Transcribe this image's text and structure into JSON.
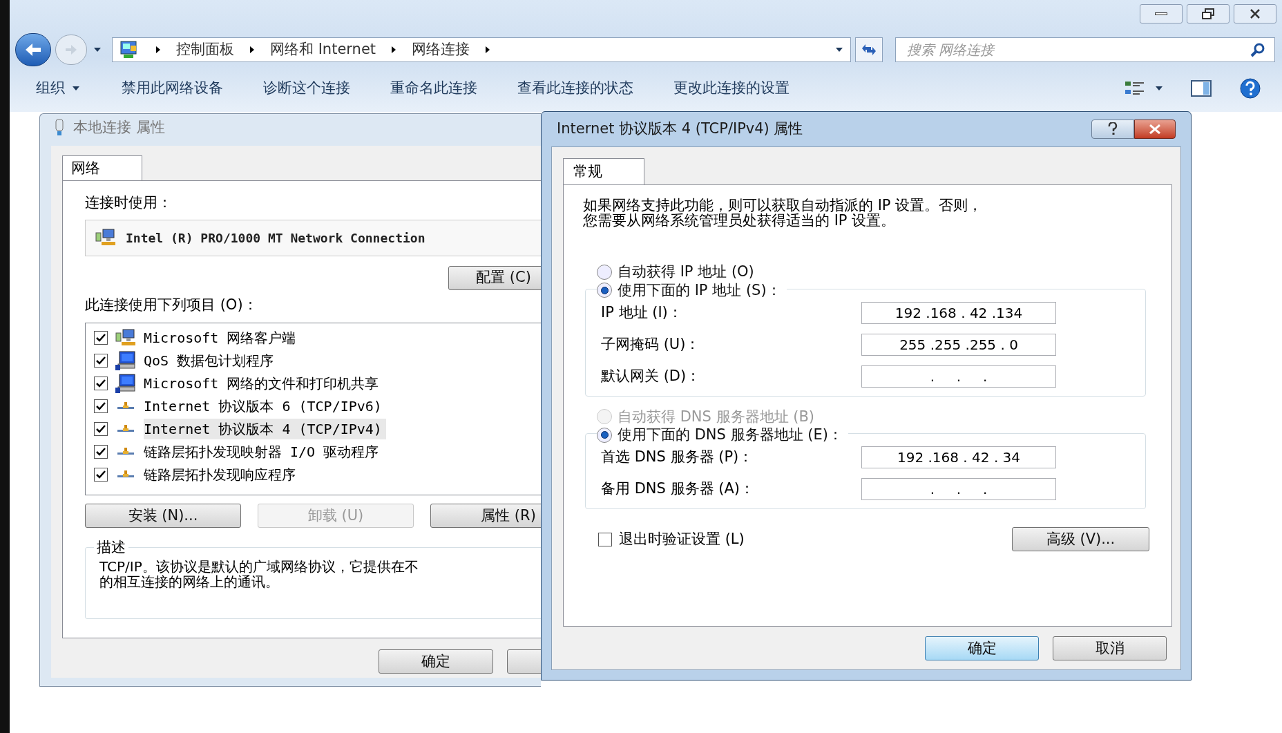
{
  "explorer": {
    "breadcrumb": [
      "控制面板",
      "网络和 Internet",
      "网络连接"
    ],
    "search": {
      "placeholder": "搜索 网络连接"
    },
    "toolbar": [
      {
        "label": "组织",
        "kind": "menu"
      },
      {
        "label": "禁用此网络设备",
        "kind": "action"
      },
      {
        "label": "诊断这个连接",
        "kind": "action"
      },
      {
        "label": "重命名此连接",
        "kind": "action"
      },
      {
        "label": "查看此连接的状态",
        "kind": "action"
      },
      {
        "label": "更改此连接的设置",
        "kind": "action"
      }
    ]
  },
  "properties_dialog": {
    "title": "本地连接 属性",
    "tabs": [
      {
        "label": "网络",
        "selected": true
      }
    ],
    "connect_using_label": "连接时使用：",
    "adapter": "Intel (R) PRO/1000 MT Network Connection",
    "configure_button": "配置 (C)",
    "items_label": "此连接使用下列项目 (O)：",
    "items": [
      {
        "label": "Microsoft 网络客户端",
        "kind": "client",
        "checked": true,
        "selected": false
      },
      {
        "label": "QoS 数据包计划程序",
        "kind": "service",
        "checked": true,
        "selected": false
      },
      {
        "label": "Microsoft 网络的文件和打印机共享",
        "kind": "service",
        "checked": true,
        "selected": false
      },
      {
        "label": "Internet 协议版本 6 (TCP/IPv6)",
        "kind": "protocol",
        "checked": true,
        "selected": false
      },
      {
        "label": "Internet 协议版本 4 (TCP/IPv4)",
        "kind": "protocol",
        "checked": true,
        "selected": true
      },
      {
        "label": "链路层拓扑发现映射器 I/O 驱动程序",
        "kind": "protocol",
        "checked": true,
        "selected": false
      },
      {
        "label": "链路层拓扑发现响应程序",
        "kind": "protocol",
        "checked": true,
        "selected": false
      }
    ],
    "buttons": [
      {
        "label": "安装 (N)...",
        "disabled": false
      },
      {
        "label": "卸载 (U)",
        "disabled": true
      },
      {
        "label": "属性 (R)",
        "disabled": false
      }
    ],
    "description": {
      "title": "描述",
      "lines": [
        "TCP/IP。该协议是默认的广域网络协议，它提供在不",
        "的相互连接的网络上的通讯。"
      ]
    },
    "footer_buttons": [
      {
        "label": "确定"
      }
    ]
  },
  "ipv4_dialog": {
    "title": "Internet 协议版本 4 (TCP/IPv4) 属性",
    "tabs": [
      {
        "label": "常规",
        "selected": true
      }
    ],
    "intro": [
      "如果网络支持此功能，则可以获取自动指派的 IP 设置。否则，",
      "您需要从网络系统管理员处获得适当的 IP 设置。"
    ],
    "ip_section": {
      "radios": [
        {
          "label": "自动获得 IP 地址 (O)",
          "selected": false,
          "disabled": false
        },
        {
          "label": "使用下面的 IP 地址 (S)：",
          "selected": true,
          "disabled": false
        }
      ],
      "fields": [
        {
          "label": "IP 地址 (I)：",
          "value": "192 .168 . 42 .134"
        },
        {
          "label": "子网掩码 (U)：",
          "value": "255 .255 .255 . 0"
        },
        {
          "label": "默认网关 (D)：",
          "value": ".     .     ."
        }
      ]
    },
    "dns_section": {
      "radios": [
        {
          "label": "自动获得 DNS 服务器地址 (B)",
          "selected": false,
          "disabled": true
        },
        {
          "label": "使用下面的 DNS 服务器地址 (E)：",
          "selected": true,
          "disabled": false
        }
      ],
      "fields": [
        {
          "label": "首选 DNS 服务器 (P)：",
          "value": "192 .168 . 42 . 34"
        },
        {
          "label": "备用 DNS 服务器 (A)：",
          "value": ".     .     ."
        }
      ]
    },
    "validate": {
      "label": "退出时验证设置 (L)",
      "checked": false
    },
    "advanced_button": "高级 (V)...",
    "ok_button": {
      "label": "确定",
      "focused": true
    },
    "cancel_button": {
      "label": "取消",
      "focused": false
    }
  }
}
